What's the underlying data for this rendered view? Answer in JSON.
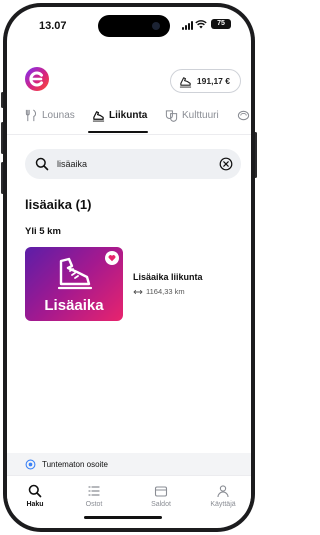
{
  "status_bar": {
    "time": "13.07",
    "battery": "75"
  },
  "header": {
    "balance": "191,17 €"
  },
  "tabs": [
    {
      "label": "Lounas",
      "icon": "fork-knife-icon"
    },
    {
      "label": "Liikunta",
      "icon": "running-shoe-icon",
      "active": true
    },
    {
      "label": "Kulttuuri",
      "icon": "theater-masks-icon"
    }
  ],
  "search": {
    "value": "lisäaika",
    "placeholder": "Hae"
  },
  "results": {
    "title": "lisäaika (1)",
    "section": "Yli 5 km",
    "items": [
      {
        "image_text": "Lisäaika",
        "name": "Lisäaika liikunta",
        "distance": "1164,33 km"
      }
    ]
  },
  "location": {
    "label": "Tuntematon osoite"
  },
  "bottom_nav": [
    {
      "label": "Haku",
      "icon": "search-icon",
      "active": true
    },
    {
      "label": "Ostot",
      "icon": "list-icon"
    },
    {
      "label": "Saldot",
      "icon": "wallet-icon"
    },
    {
      "label": "Käyttäjä",
      "icon": "user-icon"
    }
  ],
  "colors": {
    "accent": "#7b2ff7",
    "brand_pink": "#e8246d",
    "text": "#111111"
  }
}
